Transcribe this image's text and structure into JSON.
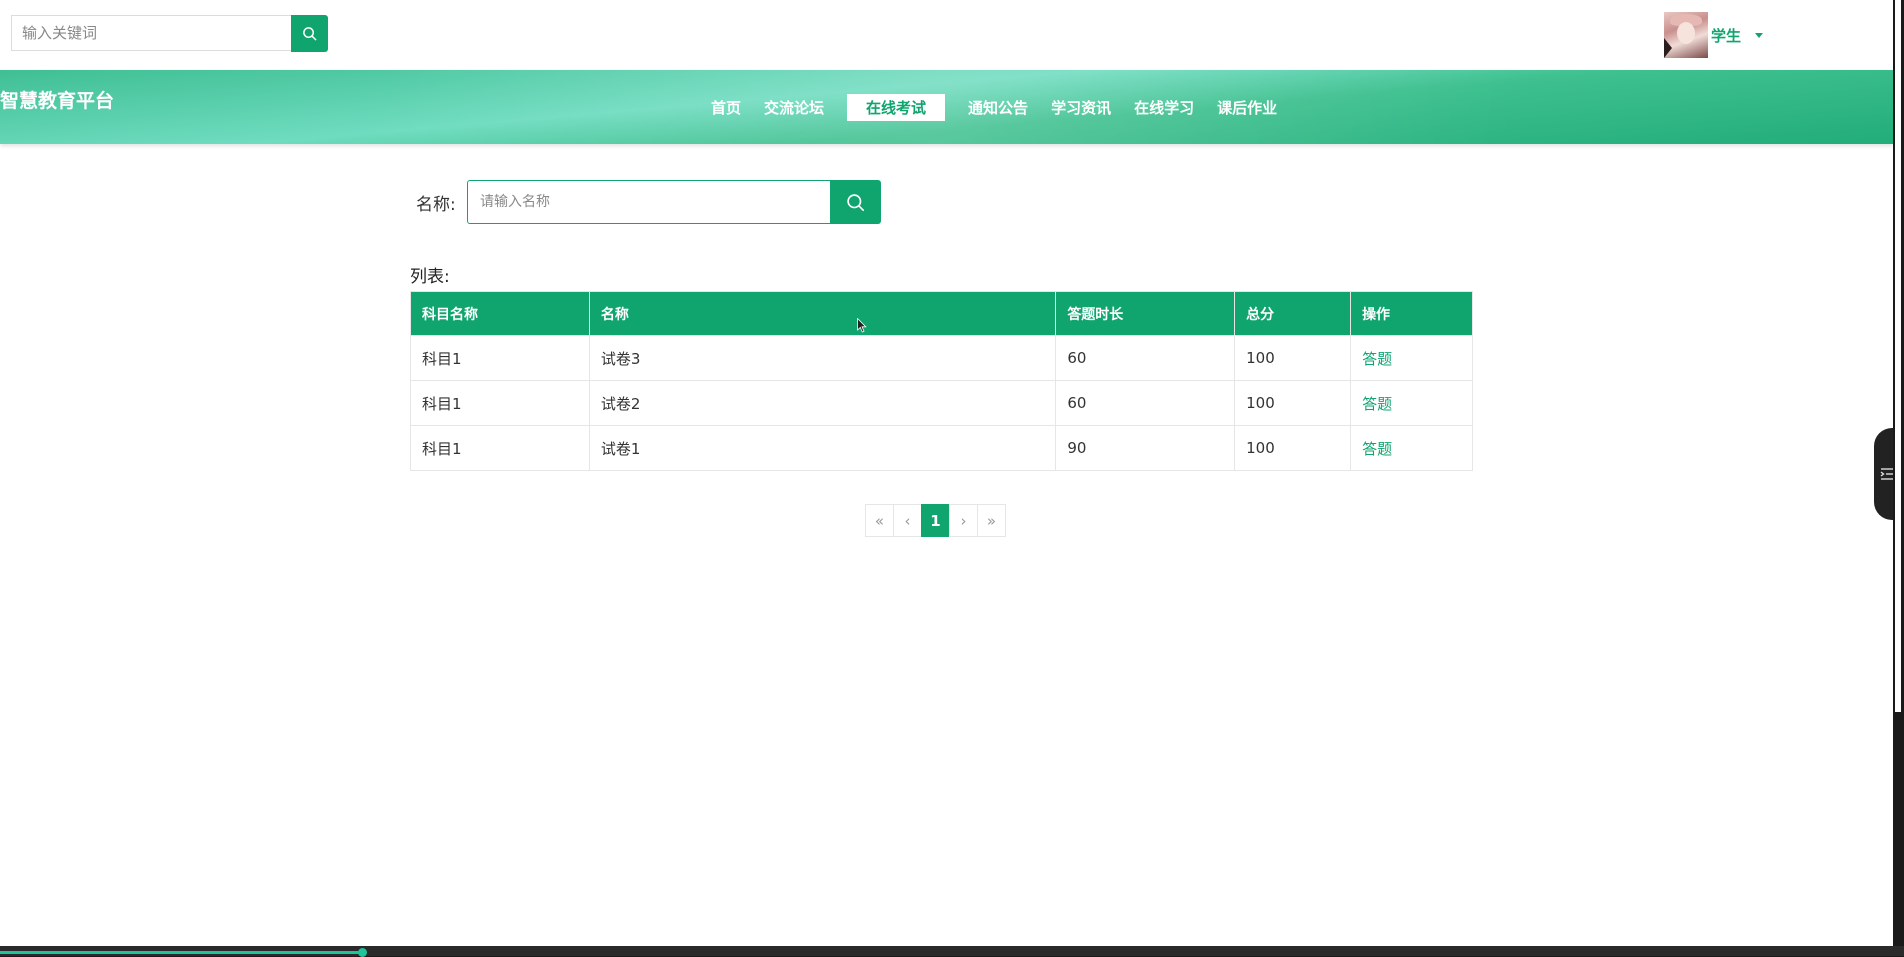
{
  "topbar": {
    "search_placeholder": "输入关键词",
    "user_name": "学生"
  },
  "header": {
    "site_title": "智慧教育平台",
    "nav": [
      {
        "label": "首页",
        "active": false
      },
      {
        "label": "交流论坛",
        "active": false
      },
      {
        "label": "在线考试",
        "active": true
      },
      {
        "label": "通知公告",
        "active": false
      },
      {
        "label": "学习资讯",
        "active": false
      },
      {
        "label": "在线学习",
        "active": false
      },
      {
        "label": "课后作业",
        "active": false
      }
    ]
  },
  "search": {
    "label": "名称:",
    "placeholder": "请输入名称"
  },
  "list": {
    "label": "列表:",
    "columns": [
      "科目名称",
      "名称",
      "答题时长",
      "总分",
      "操作"
    ],
    "rows": [
      {
        "subject": "科目1",
        "name": "试卷3",
        "duration": "60",
        "score": "100",
        "action": "答题"
      },
      {
        "subject": "科目1",
        "name": "试卷2",
        "duration": "60",
        "score": "100",
        "action": "答题"
      },
      {
        "subject": "科目1",
        "name": "试卷1",
        "duration": "90",
        "score": "100",
        "action": "答题"
      }
    ]
  },
  "pagination": {
    "first": "«",
    "prev": "‹",
    "current": "1",
    "next": "›",
    "last": "»"
  },
  "icons": {
    "search": "search-icon",
    "caret": "caret-down-icon",
    "side_menu": "list-menu-icon"
  },
  "colors": {
    "accent": "#10a56f",
    "banner_light": "#6fdcc0"
  },
  "progress": {
    "bottom_fraction": 0.19
  }
}
